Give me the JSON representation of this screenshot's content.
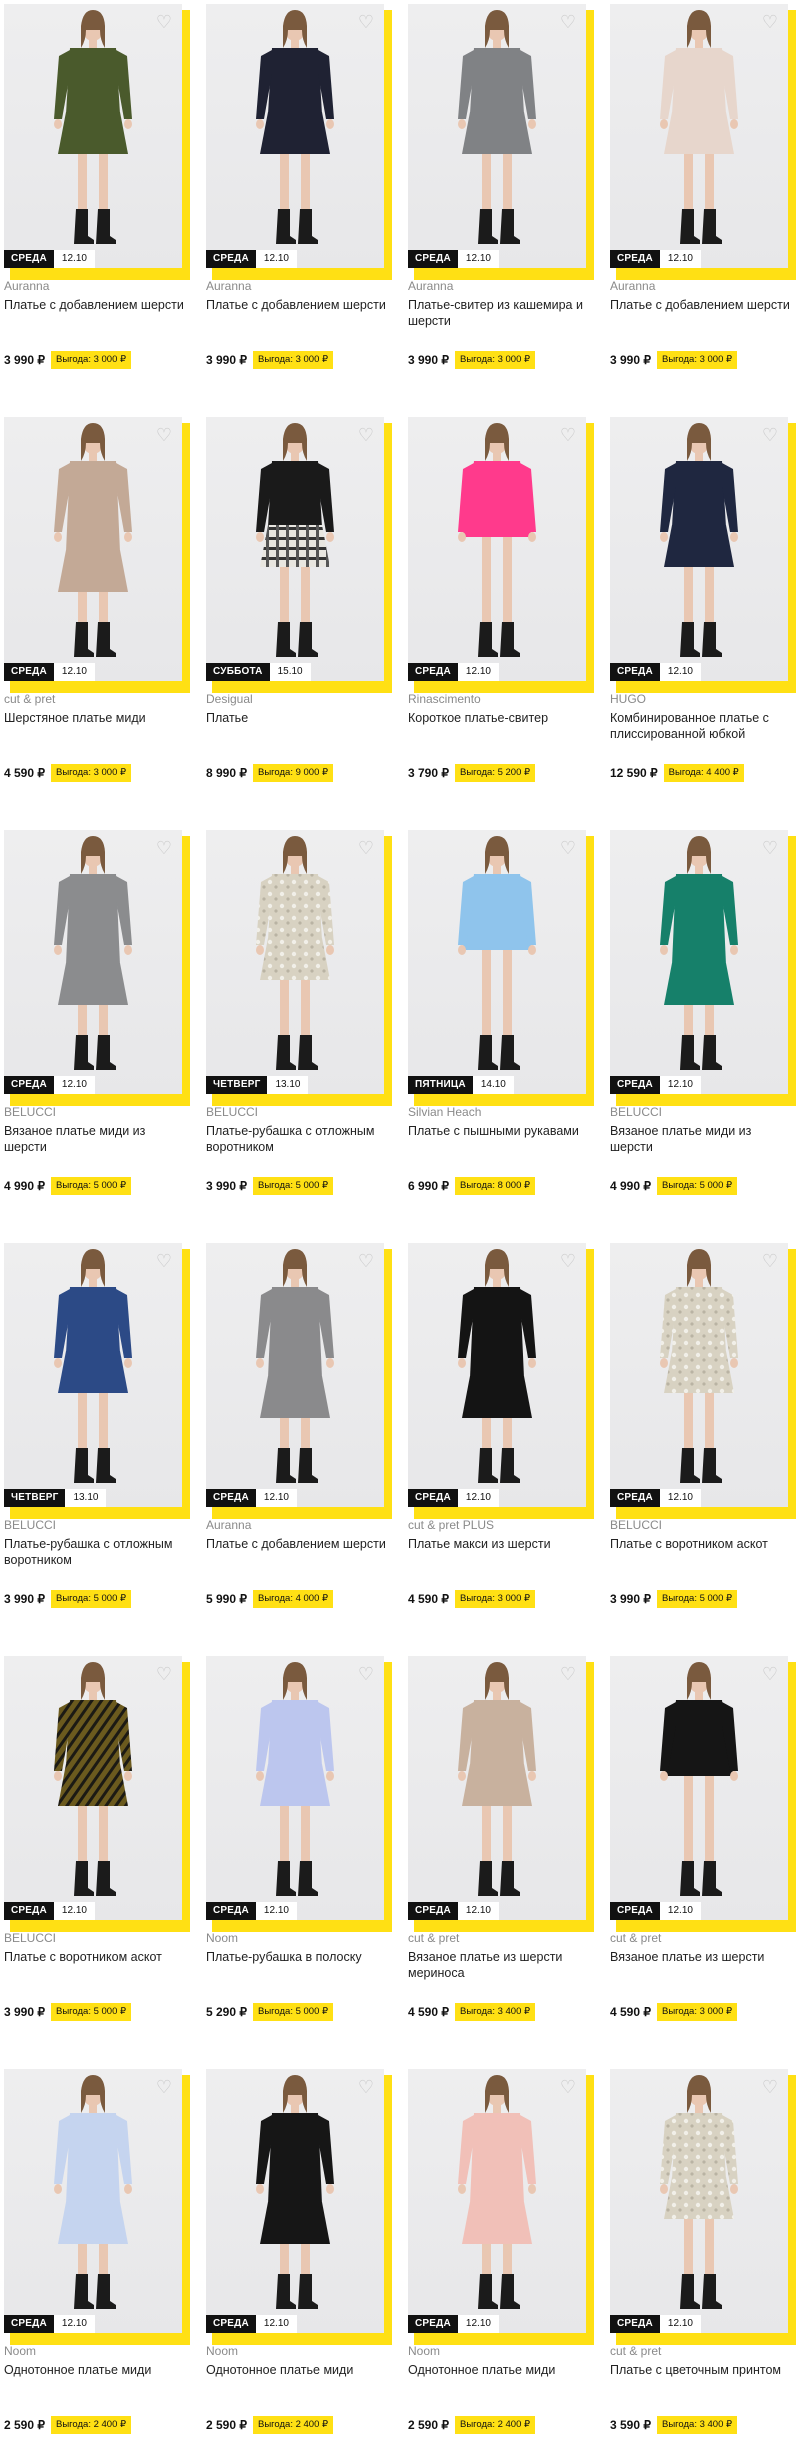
{
  "favorite_icon": "heart-outline-icon",
  "colors": {
    "accent": "#ffe014",
    "badge_bg": "#111111"
  },
  "products": [
    {
      "brand": "Auranna",
      "title": "Платье с добавлением шерсти",
      "price": "3 990 ₽",
      "saving": "Выгода: 3 000 ₽",
      "day": "СРЕДА",
      "date": "12.10",
      "dress_color": "#4a5a2c",
      "style": "knit"
    },
    {
      "brand": "Auranna",
      "title": "Платье с добавлением шерсти",
      "price": "3 990 ₽",
      "saving": "Выгода: 3 000 ₽",
      "day": "СРЕДА",
      "date": "12.10",
      "dress_color": "#1f2233",
      "style": "knit"
    },
    {
      "brand": "Auranna",
      "title": "Платье-свитер из кашемира и шерсти",
      "price": "3 990 ₽",
      "saving": "Выгода: 3 000 ₽",
      "day": "СРЕДА",
      "date": "12.10",
      "dress_color": "#808285",
      "style": "knit"
    },
    {
      "brand": "Auranna",
      "title": "Платье с добавлением шерсти",
      "price": "3 990 ₽",
      "saving": "Выгода: 3 000 ₽",
      "day": "СРЕДА",
      "date": "12.10",
      "dress_color": "#e7d6cc",
      "style": "knit"
    },
    {
      "brand": "cut & pret",
      "title": "Шерстяное платье миди",
      "price": "4 590 ₽",
      "saving": "Выгода: 3 000 ₽",
      "day": "СРЕДА",
      "date": "12.10",
      "dress_color": "#c3a996",
      "style": "long"
    },
    {
      "brand": "Desigual",
      "title": "Платье",
      "price": "8 990 ₽",
      "saving": "Выгода: 9 000 ₽",
      "day": "СУББОТА",
      "date": "15.10",
      "dress_color": "#1a1a1a",
      "style": "plaid"
    },
    {
      "brand": "Rinascimento",
      "title": "Короткое платье-свитер",
      "price": "3 790 ₽",
      "saving": "Выгода: 5 200 ₽",
      "day": "СРЕДА",
      "date": "12.10",
      "dress_color": "#ff3a8c",
      "style": "short"
    },
    {
      "brand": "HUGO",
      "title": "Комбинированное платье с плиссированной юбкой",
      "price": "12 590 ₽",
      "saving": "Выгода: 4 400 ₽",
      "day": "СРЕДА",
      "date": "12.10",
      "dress_color": "#1f2740",
      "style": "knit"
    },
    {
      "brand": "BELUCCI",
      "title": "Вязаное платье миди из шерсти",
      "price": "4 990 ₽",
      "saving": "Выгода: 5 000 ₽",
      "day": "СРЕДА",
      "date": "12.10",
      "dress_color": "#8b8c8e",
      "style": "long"
    },
    {
      "brand": "BELUCCI",
      "title": "Платье-рубашка с отложным воротником",
      "price": "3 990 ₽",
      "saving": "Выгода: 5 000 ₽",
      "day": "ЧЕТВЕРГ",
      "date": "13.10",
      "dress_color": "#d8d2c2",
      "style": "print"
    },
    {
      "brand": "Silvian Heach",
      "title": "Платье с пышными рукавами",
      "price": "6 990 ₽",
      "saving": "Выгода: 8 000 ₽",
      "day": "ПЯТНИЦА",
      "date": "14.10",
      "dress_color": "#8fc4ec",
      "style": "short"
    },
    {
      "brand": "BELUCCI",
      "title": "Вязаное платье миди из шерсти",
      "price": "4 990 ₽",
      "saving": "Выгода: 5 000 ₽",
      "day": "СРЕДА",
      "date": "12.10",
      "dress_color": "#16806a",
      "style": "long"
    },
    {
      "brand": "BELUCCI",
      "title": "Платье-рубашка с отложным воротником",
      "price": "3 990 ₽",
      "saving": "Выгода: 5 000 ₽",
      "day": "ЧЕТВЕРГ",
      "date": "13.10",
      "dress_color": "#2c4a86",
      "style": "knit"
    },
    {
      "brand": "Auranna",
      "title": "Платье с добавлением шерсти",
      "price": "5 990 ₽",
      "saving": "Выгода: 4 000 ₽",
      "day": "СРЕДА",
      "date": "12.10",
      "dress_color": "#8a8a8c",
      "style": "long"
    },
    {
      "brand": "cut & pret PLUS",
      "title": "Платье макси из шерсти",
      "price": "4 590 ₽",
      "saving": "Выгода: 3 000 ₽",
      "day": "СРЕДА",
      "date": "12.10",
      "dress_color": "#141414",
      "style": "long"
    },
    {
      "brand": "BELUCCI",
      "title": "Платье с воротником аскот",
      "price": "3 990 ₽",
      "saving": "Выгода: 5 000 ₽",
      "day": "СРЕДА",
      "date": "12.10",
      "dress_color": "#2a2a30",
      "style": "print"
    },
    {
      "brand": "BELUCCI",
      "title": "Платье с воротником аскот",
      "price": "3 990 ₽",
      "saving": "Выгода: 5 000 ₽",
      "day": "СРЕДА",
      "date": "12.10",
      "dress_color": "#6b5a1e",
      "style": "stripe"
    },
    {
      "brand": "Noom",
      "title": "Платье-рубашка в полоску",
      "price": "5 290 ₽",
      "saving": "Выгода: 5 000 ₽",
      "day": "СРЕДА",
      "date": "12.10",
      "dress_color": "#bcc6ee",
      "style": "knit"
    },
    {
      "brand": "cut & pret",
      "title": "Вязаное платье из шерсти мериноса",
      "price": "4 590 ₽",
      "saving": "Выгода: 3 400 ₽",
      "day": "СРЕДА",
      "date": "12.10",
      "dress_color": "#c8b19e",
      "style": "knit"
    },
    {
      "brand": "cut & pret",
      "title": "Вязаное платье из шерсти",
      "price": "4 590 ₽",
      "saving": "Выгода: 3 000 ₽",
      "day": "СРЕДА",
      "date": "12.10",
      "dress_color": "#151515",
      "style": "short"
    },
    {
      "brand": "Noom",
      "title": "Однотонное платье миди",
      "price": "2 590 ₽",
      "saving": "Выгода: 2 400 ₽",
      "day": "СРЕДА",
      "date": "12.10",
      "dress_color": "#c5d4ef",
      "style": "long"
    },
    {
      "brand": "Noom",
      "title": "Однотонное платье миди",
      "price": "2 590 ₽",
      "saving": "Выгода: 2 400 ₽",
      "day": "СРЕДА",
      "date": "12.10",
      "dress_color": "#161616",
      "style": "long"
    },
    {
      "brand": "Noom",
      "title": "Однотонное платье миди",
      "price": "2 590 ₽",
      "saving": "Выгода: 2 400 ₽",
      "day": "СРЕДА",
      "date": "12.10",
      "dress_color": "#f1c0b8",
      "style": "long"
    },
    {
      "brand": "cut & pret",
      "title": "Платье с цветочным принтом",
      "price": "3 590 ₽",
      "saving": "Выгода: 3 400 ₽",
      "day": "СРЕДА",
      "date": "12.10",
      "dress_color": "#2a2622",
      "style": "print"
    }
  ]
}
